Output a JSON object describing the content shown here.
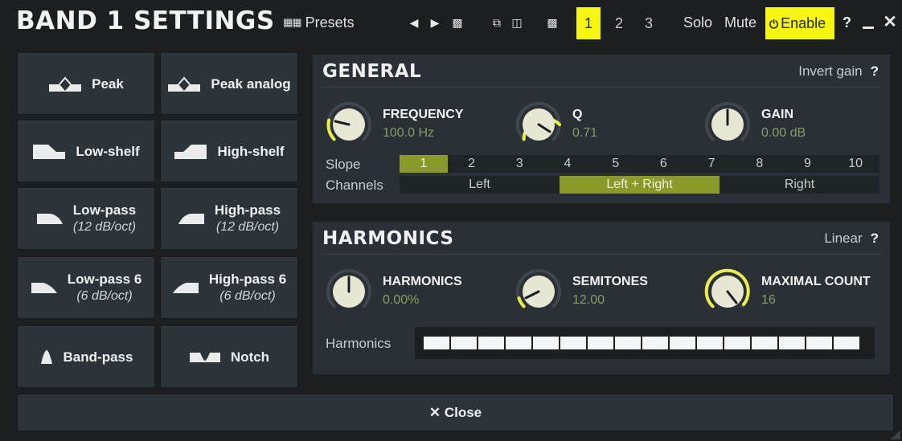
{
  "app": {
    "title": "BAND 1 SETTINGS"
  },
  "toolbar": {
    "presets_label": "Presets",
    "band_numbers": [
      "1",
      "2",
      "3"
    ],
    "active_band": "1",
    "solo_label": "Solo",
    "mute_label": "Mute",
    "enable_label": "Enable",
    "help_label": "?",
    "accent_color": "#f5f710"
  },
  "filters": [
    {
      "label": "Peak",
      "sub": "",
      "icon": "peak-shape-icon"
    },
    {
      "label": "Peak analog",
      "sub": "",
      "icon": "peak-analog-shape-icon"
    },
    {
      "label": "Low-shelf",
      "sub": "",
      "icon": "low-shelf-shape-icon"
    },
    {
      "label": "High-shelf",
      "sub": "",
      "icon": "high-shelf-shape-icon"
    },
    {
      "label": "Low-pass",
      "sub": "(12 dB/oct)",
      "icon": "low-pass-shape-icon"
    },
    {
      "label": "High-pass",
      "sub": "(12 dB/oct)",
      "icon": "high-pass-shape-icon"
    },
    {
      "label": "Low-pass 6",
      "sub": "(6 dB/oct)",
      "icon": "low-pass-6-shape-icon"
    },
    {
      "label": "High-pass 6",
      "sub": "(6 dB/oct)",
      "icon": "high-pass-6-shape-icon"
    },
    {
      "label": "Band-pass",
      "sub": "",
      "icon": "band-pass-shape-icon"
    },
    {
      "label": "Notch",
      "sub": "",
      "icon": "notch-shape-icon"
    }
  ],
  "general": {
    "title": "GENERAL",
    "invert_gain_label": "Invert gain",
    "help_label": "?",
    "knobs": [
      {
        "name": "FREQUENCY",
        "value": "100.0 Hz"
      },
      {
        "name": "Q",
        "value": "0.71"
      },
      {
        "name": "GAIN",
        "value": "0.00 dB"
      }
    ],
    "slope_label": "Slope",
    "slope_options": [
      "1",
      "2",
      "3",
      "4",
      "5",
      "6",
      "7",
      "8",
      "9",
      "10"
    ],
    "slope_selected": "1",
    "channels_label": "Channels",
    "channel_options": [
      "Left",
      "Left + Right",
      "Right"
    ],
    "channel_selected": "Left + Right"
  },
  "harmonics": {
    "title": "HARMONICS",
    "mode_label": "Linear",
    "help_label": "?",
    "knobs": [
      {
        "name": "HARMONICS",
        "value": "0.00%"
      },
      {
        "name": "SEMITONES",
        "value": "12.00"
      },
      {
        "name": "MAXIMAL COUNT",
        "value": "16"
      }
    ],
    "strip_label": "Harmonics",
    "strip_cells": 16
  },
  "close_label": "Close",
  "colors": {
    "accent": "#f5f710",
    "value_text": "#8a9a63",
    "selected_segment": "#8a9a2a"
  }
}
